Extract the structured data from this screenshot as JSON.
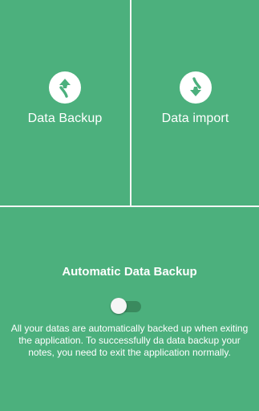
{
  "tiles": {
    "backup": {
      "label": "Data Backup",
      "icon": "backup-arrow-up-icon"
    },
    "import": {
      "label": "Data import",
      "icon": "import-arrow-down-icon"
    }
  },
  "auto_backup": {
    "title": "Automatic Data Backup",
    "toggle_on": false,
    "description": "All your datas are automatically backed up when exiting the application. To successfully da data backup your notes, you need to exit the application normally."
  },
  "colors": {
    "background": "#4cb07d",
    "icon_arrow": "#4cb07d",
    "toggle_track": "#3a8a5e",
    "toggle_thumb": "#f5f5f5",
    "text": "#ffffff"
  }
}
